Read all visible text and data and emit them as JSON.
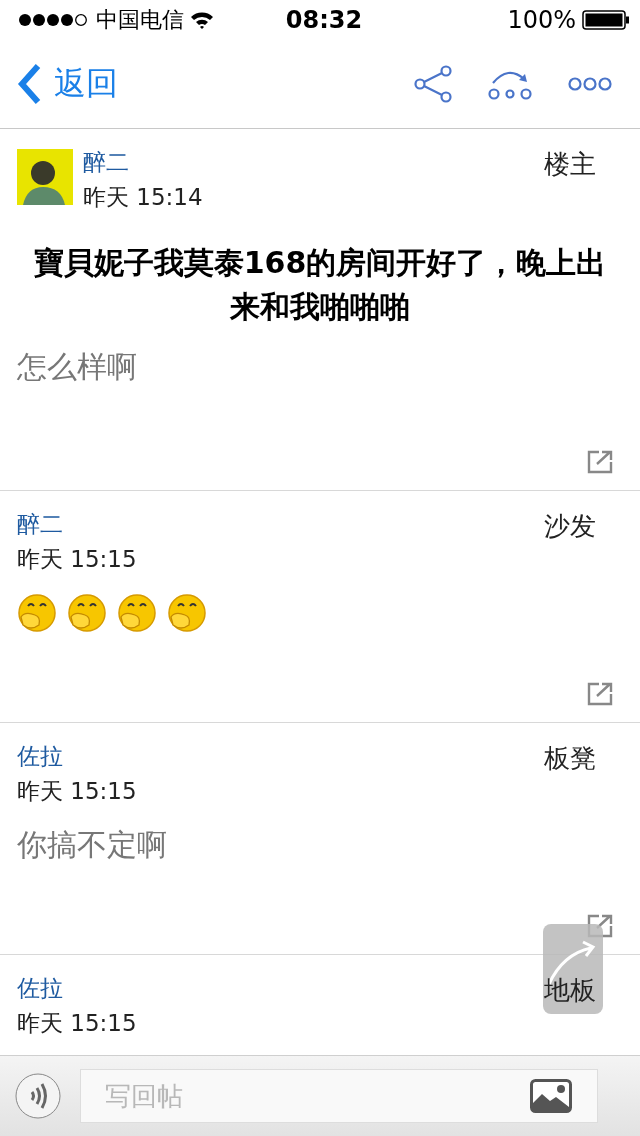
{
  "status_bar": {
    "carrier": "中国电信",
    "time": "08:32",
    "battery": "100%"
  },
  "nav": {
    "back": "返回"
  },
  "posts": [
    {
      "author": "醉二",
      "time": "昨天 15:14",
      "floor": "楼主",
      "avatar": true,
      "title": "寶貝妮子我莫泰168的房间开好了，晚上出来和我啪啪啪",
      "body": {
        "kind": "text",
        "text": "怎么样啊"
      },
      "share": true
    },
    {
      "author": "醉二",
      "time": "昨天 15:15",
      "floor": "沙发",
      "avatar": false,
      "body": {
        "kind": "emojis",
        "emojis": [
          {
            "kind": "cover-mouth"
          },
          {
            "kind": "cover-mouth"
          },
          {
            "kind": "cover-mouth"
          },
          {
            "kind": "cover-mouth"
          }
        ]
      },
      "share": true
    },
    {
      "author": "佐拉",
      "time": "昨天 15:15",
      "floor": "板凳",
      "avatar": false,
      "body": {
        "kind": "text",
        "text": "你搞不定啊"
      },
      "share": true
    },
    {
      "author": "佐拉",
      "time": "昨天 15:15",
      "floor": "地板",
      "avatar": false,
      "share": false
    }
  ],
  "reply": {
    "placeholder": "写回帖"
  }
}
